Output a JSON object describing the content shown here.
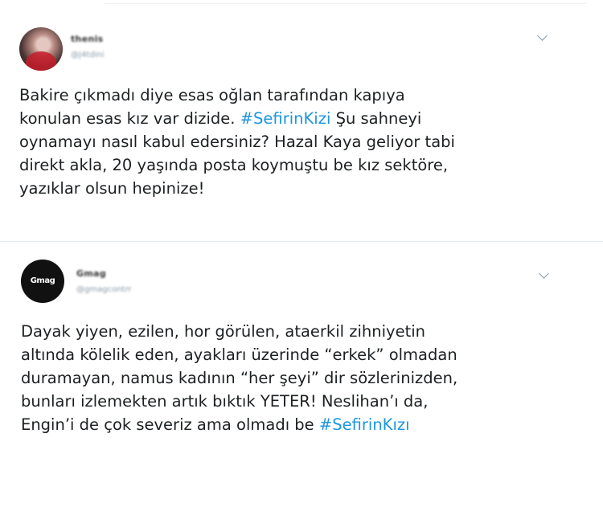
{
  "tweets": [
    {
      "display_name": "thenis",
      "handle": "@J4tdini",
      "text_before": "Bakire çıkmadı diye esas oğlan tarafından kapıya\nkonulan esas kız var dizide. ",
      "hashtag": "#SefirinKizi",
      "text_after": " Şu sahneyi\noynamayı nasıl kabul edersiniz? Hazal Kaya geliyor tabi\ndirekt akla, 20 yaşında posta koymuştu be kız sektöre,\nyazıklar olsun hepinize!"
    },
    {
      "display_name": "Gmag",
      "handle": "@gmagcontrr",
      "avatar_logo": "Gmag",
      "text_before": "Dayak yiyen, ezilen, hor görülen, ataerkil zihniyetin\naltında kölelik eden, ayakları üzerinde “erkek” olmadan\nduramayan, namus kadının “her şeyi” dir sözlerinizden,\nbunları izlemekten artık bıktık YETER! Neslihan’ı da,\nEngin’i de çok severiz ama olmadı be ",
      "hashtag": "#SefirinKızı",
      "text_after": ""
    }
  ],
  "colors": {
    "hashtag": "#1b95e0",
    "text": "#1c2022",
    "muted": "#8899a6",
    "divider": "#e6ecf0"
  },
  "icons": {
    "menu": "chevron-down-icon"
  }
}
